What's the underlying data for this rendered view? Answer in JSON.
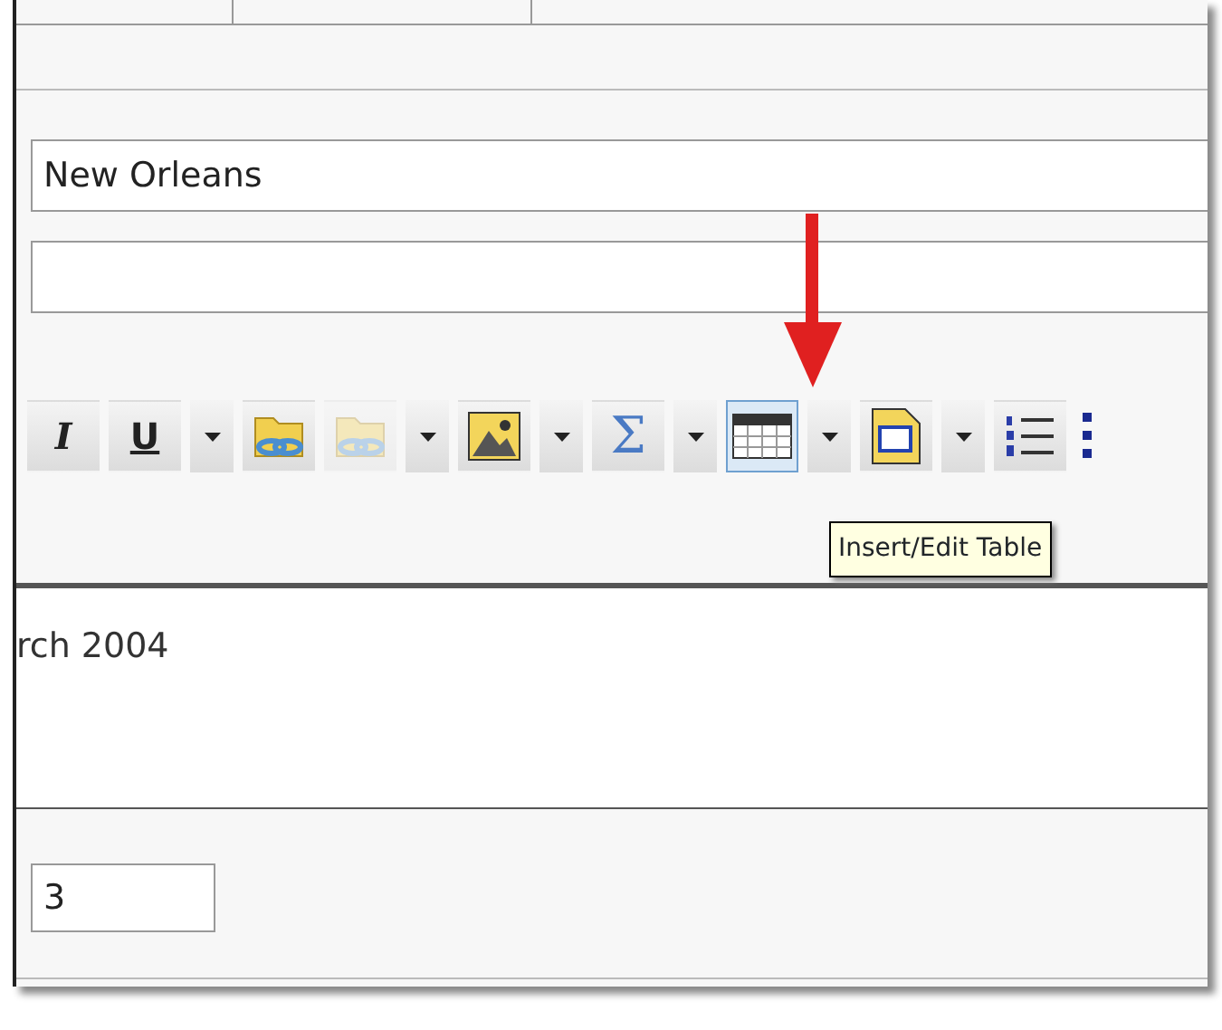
{
  "fields": [
    {
      "kind": "text",
      "value": "New Orleans"
    },
    {
      "kind": "text"
    }
  ],
  "toolbar": [
    {
      "kind": "italic",
      "label": "I",
      "selected": false,
      "disabled": false
    },
    {
      "kind": "underline",
      "label": "U",
      "selected": false,
      "disabled": false
    },
    {
      "kind": "dropdown"
    },
    {
      "kind": "link",
      "selected": false,
      "disabled": false
    },
    {
      "kind": "link",
      "selected": false,
      "disabled": true
    },
    {
      "kind": "dropdown"
    },
    {
      "kind": "image",
      "selected": false,
      "disabled": false
    },
    {
      "kind": "dropdown"
    },
    {
      "kind": "sum",
      "label": "Σ",
      "selected": false,
      "disabled": false
    },
    {
      "kind": "dropdown"
    },
    {
      "kind": "table",
      "selected": true,
      "disabled": false
    },
    {
      "kind": "dropdown"
    },
    {
      "kind": "frame",
      "selected": false,
      "disabled": false
    },
    {
      "kind": "dropdown"
    },
    {
      "kind": "list",
      "selected": false,
      "disabled": false
    },
    {
      "kind": "partial",
      "selected": false,
      "disabled": false
    }
  ],
  "tooltip": "Insert/Edit Table",
  "editor": {
    "text": "rch 2004"
  },
  "number_field": {
    "value": "3"
  }
}
